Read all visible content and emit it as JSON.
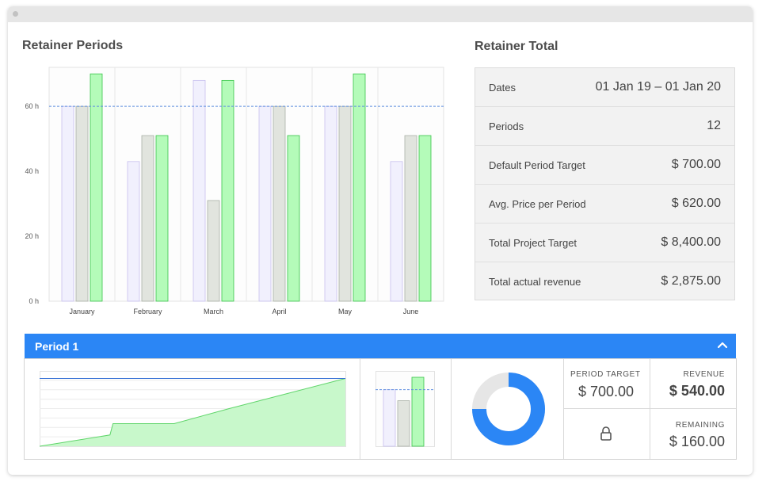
{
  "retainer_periods": {
    "title": "Retainer Periods"
  },
  "chart_data": {
    "type": "bar",
    "title": "Retainer Periods",
    "categories": [
      "January",
      "February",
      "March",
      "April",
      "May",
      "June"
    ],
    "y_tick_labels": [
      "0 h",
      "20 h",
      "40 h",
      "60 h"
    ],
    "ylim": [
      0,
      72
    ],
    "reference_line": 60,
    "series": [
      {
        "values": [
          60,
          43,
          68,
          60,
          60,
          43
        ],
        "color": "#f1f0fd"
      },
      {
        "values": [
          60,
          51,
          31,
          60,
          60,
          51
        ],
        "color": "#e1e4de"
      },
      {
        "values": [
          70,
          51,
          68,
          51,
          70,
          51
        ],
        "color": "#b4fbb9"
      }
    ]
  },
  "retainer_total": {
    "title": "Retainer Total",
    "rows": [
      {
        "label": "Dates",
        "value": "01 Jan 19  –  01 Jan 20"
      },
      {
        "label": "Periods",
        "value": "12"
      },
      {
        "label": "Default Period Target",
        "value": "$ 700.00"
      },
      {
        "label": "Avg. Price per Period",
        "value": "$ 620.00"
      },
      {
        "label": "Total Project Target",
        "value": "$ 8,400.00"
      },
      {
        "label": "Total actual revenue",
        "value": "$ 2,875.00"
      }
    ]
  },
  "period": {
    "title": "Period 1",
    "mini_line": {
      "target": 0.9,
      "values": [
        0,
        0.15,
        0.3,
        0.3,
        0.5,
        0.7,
        0.9
      ]
    },
    "mini_bars": {
      "values": [
        0.82,
        0.66,
        1.0
      ],
      "target": 0.82
    },
    "donut_fraction": 0.75,
    "period_target_label": "PERIOD TARGET",
    "period_target_value": "$ 700.00",
    "revenue_label": "REVENUE",
    "revenue_value": "$ 540.00",
    "remaining_label": "REMAINING",
    "remaining_value": "$ 160.00"
  },
  "icons": {
    "chevron": "chevron-up-icon",
    "lock": "lock-icon"
  },
  "colors": {
    "accent": "#2b86f5",
    "green_bar": "#b4fbb9",
    "grey_bar": "#e1e4de",
    "lavender_bar": "#f1f0fd",
    "donut_track": "#e6e6e6"
  }
}
